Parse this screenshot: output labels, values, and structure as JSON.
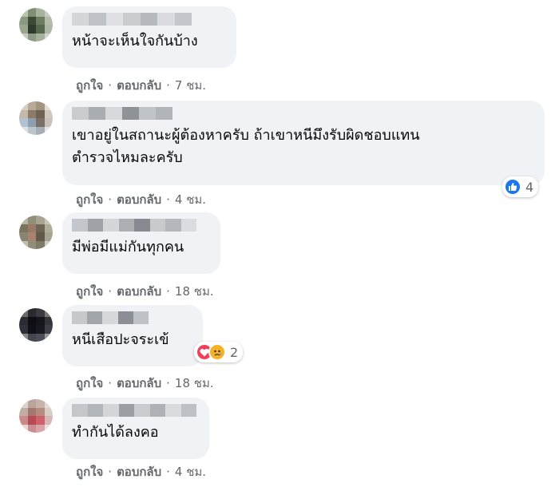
{
  "comments": [
    {
      "text": "หน้าจะเห็นใจกันบ้าง",
      "like": "ถูกใจ",
      "reply": "ตอบกลับ",
      "sep": "·",
      "time": "7 ชม."
    },
    {
      "text": "เขาอยู่ในสถานะผู้ต้องหาครับ ถ้าเขาหนีมึงรับผิดชอบแทน\nตำรวจไหมละครับ",
      "like": "ถูกใจ",
      "reply": "ตอบกลับ",
      "sep": "·",
      "time": "4 ชม.",
      "reaction_count": "4",
      "reaction_icons": [
        "like-icon"
      ]
    },
    {
      "text": "มีพ่อมีแม่กันทุกคน",
      "like": "ถูกใจ",
      "reply": "ตอบกลับ",
      "sep": "·",
      "time": "18 ชม."
    },
    {
      "text": "หนีเสือปะจระเข้",
      "like": "ถูกใจ",
      "reply": "ตอบกลับ",
      "sep": "·",
      "time": "18 ชม.",
      "reaction_count": "2",
      "reaction_icons": [
        "love-icon",
        "sad-icon"
      ]
    },
    {
      "text": "ทำกันได้ลงคอ",
      "like": "ถูกใจ",
      "reply": "ตอบกลับ",
      "sep": "·",
      "time": "4 ชม."
    }
  ],
  "colors": {
    "bubble": "#f0f2f5",
    "meta": "#65676b",
    "like": "#1877f2",
    "love": "#f33e58",
    "sad": "#f7b125"
  }
}
